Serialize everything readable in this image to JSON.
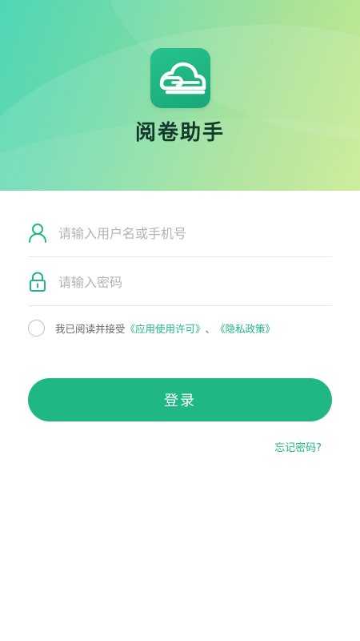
{
  "app": {
    "title": "阅卷助手",
    "icon": "cloud-document-icon",
    "brand_color": "#1fb784"
  },
  "form": {
    "username_placeholder": "请输入用户名或手机号",
    "username_value": "",
    "password_placeholder": "请输入密码",
    "password_value": "",
    "user_icon": "user-icon",
    "lock_icon": "lock-icon"
  },
  "agreement": {
    "checked": false,
    "prefix": "我已阅读并接受",
    "app_license": "《应用使用许可》",
    "separator": "、",
    "privacy_policy": "《隐私政策》"
  },
  "actions": {
    "login_label": "登录",
    "forgot_label": "忘记密码?"
  }
}
